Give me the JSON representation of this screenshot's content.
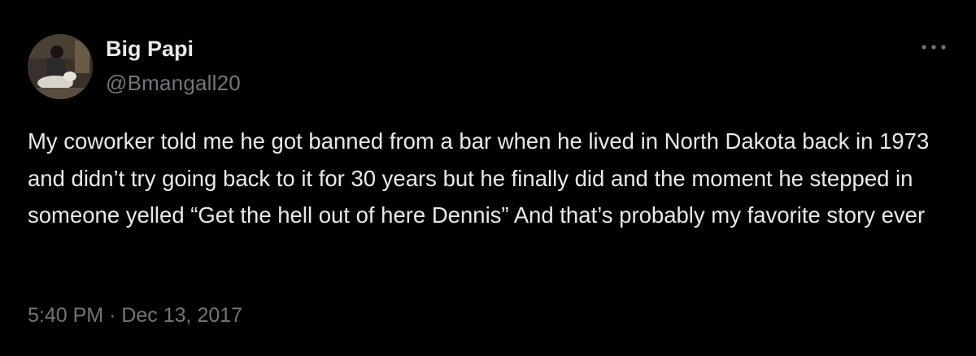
{
  "author": {
    "display_name": "Big Papi",
    "handle": "@Bmangall20",
    "avatar_icon": "profile-photo-avatar"
  },
  "more_icon": "more-horizontal-icon",
  "tweet": {
    "text": "My coworker told me he got banned from a bar when he lived in North Dakota back in 1973 and didn’t try going back to it for 30 years but he finally did and the moment he stepped in someone yelled “Get the hell out of here Dennis” And that’s probably my favorite story ever",
    "time": "5:40 PM",
    "separator": "·",
    "date": "Dec 13, 2017"
  },
  "colors": {
    "background": "#000000",
    "primary_text": "#e7e9ea",
    "secondary_text": "#71767b"
  }
}
